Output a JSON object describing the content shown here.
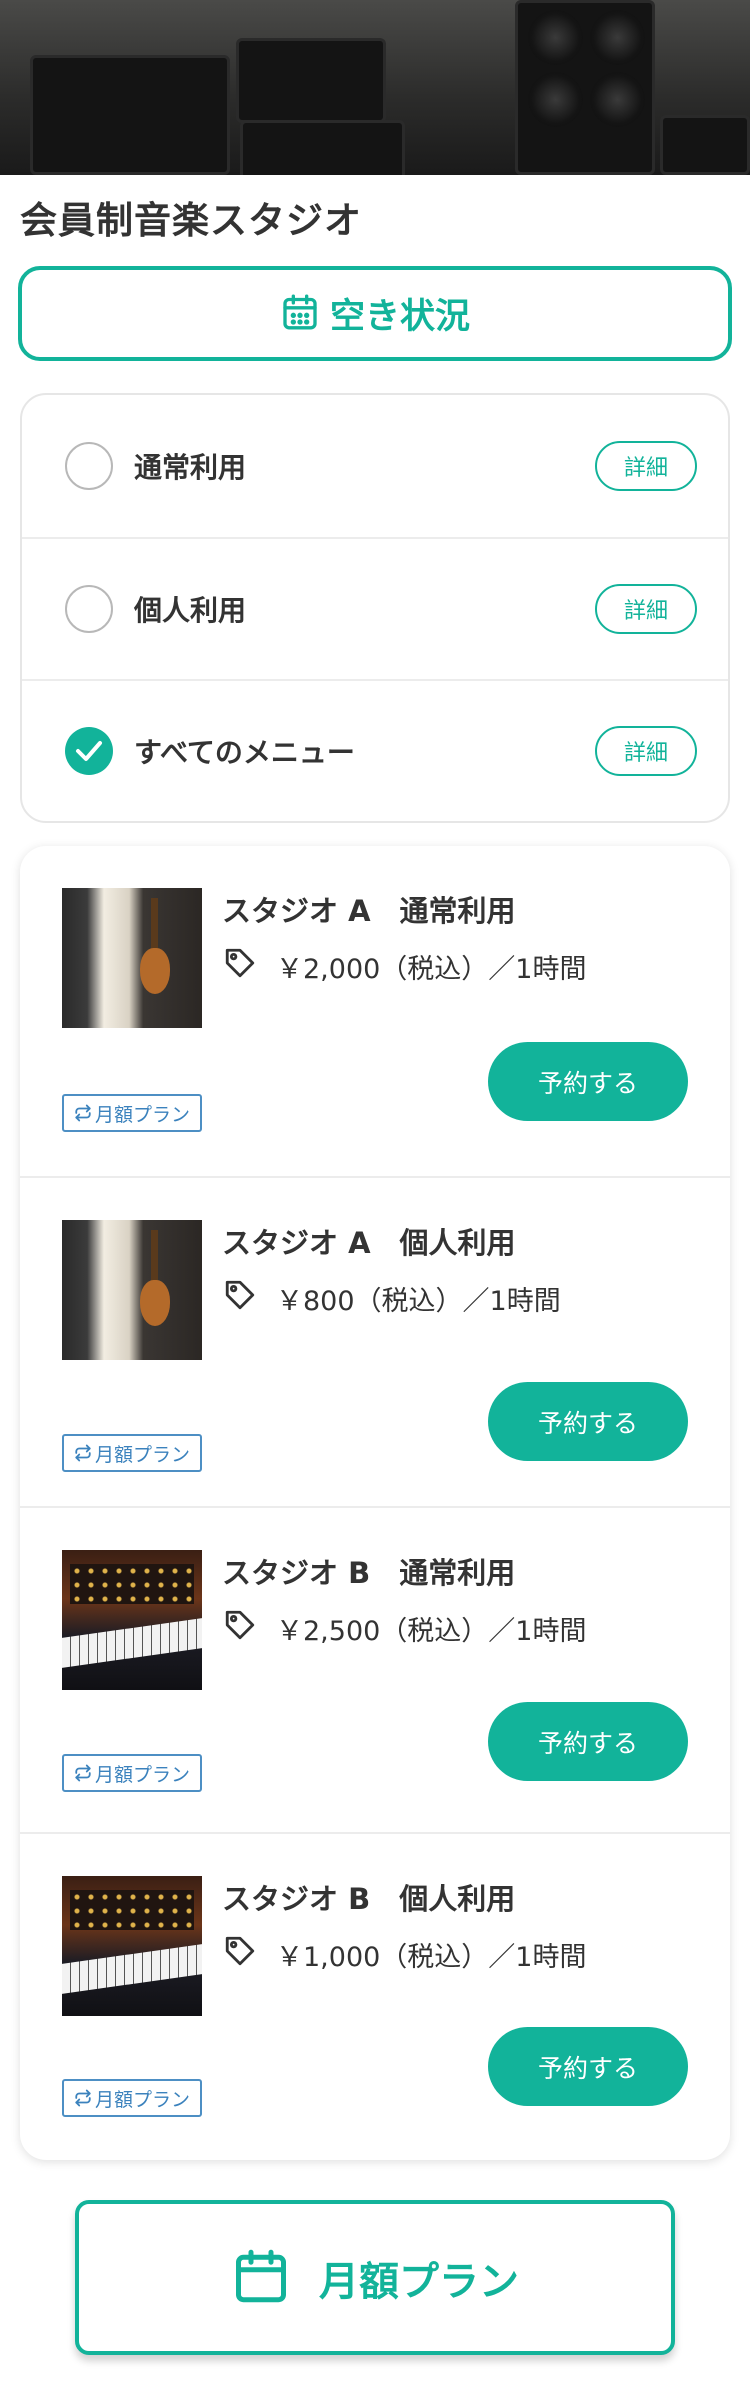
{
  "page": {
    "title": "会員制音楽スタジオ",
    "accent_color": "#12b39a"
  },
  "hero": {
    "image": "studio-amplifiers-photo"
  },
  "availability_button": {
    "label": "空き状況",
    "icon": "calendar-icon"
  },
  "menu": {
    "detail_label": "詳細",
    "options": [
      {
        "label": "通常利用",
        "selected": false
      },
      {
        "label": "個人利用",
        "selected": false
      },
      {
        "label": "すべてのメニュー",
        "selected": true
      }
    ]
  },
  "studios": [
    {
      "name": "スタジオ A　通常利用",
      "price": "￥2,000（税込）／1時間",
      "plan_badge": "月額プラン",
      "reserve_label": "予約する",
      "thumbnail": "studio-a-photo"
    },
    {
      "name": "スタジオ A　個人利用",
      "price": "￥800（税込）／1時間",
      "plan_badge": "月額プラン",
      "reserve_label": "予約する",
      "thumbnail": "studio-a-photo"
    },
    {
      "name": "スタジオ B　通常利用",
      "price": "￥2,500（税込）／1時間",
      "plan_badge": "月額プラン",
      "reserve_label": "予約する",
      "thumbnail": "studio-b-photo"
    },
    {
      "name": "スタジオ B　個人利用",
      "price": "￥1,000（税込）／1時間",
      "plan_badge": "月額プラン",
      "reserve_label": "予約する",
      "thumbnail": "studio-b-photo"
    }
  ],
  "monthly_plan_button": {
    "label": "月額プラン",
    "icon": "calendar-icon"
  }
}
